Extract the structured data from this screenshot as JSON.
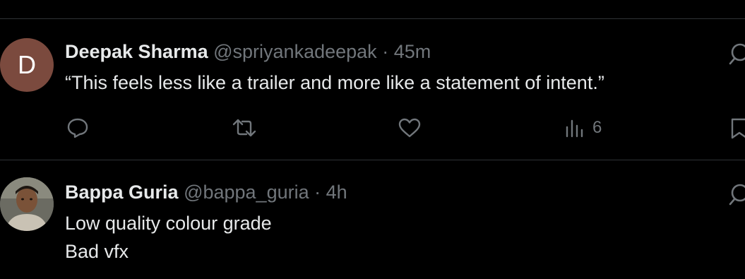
{
  "posts": [
    {
      "avatar_letter": "D",
      "name": "Deepak Sharma",
      "handle": "@spriyankadeepak",
      "separator": "·",
      "time": "45m",
      "text_lines": [
        "“This feels less like a trailer and more like a statement of intent.”"
      ],
      "views": "6"
    },
    {
      "name": "Bappa Guria",
      "handle": "@bappa_guria",
      "separator": "·",
      "time": "4h",
      "text_lines": [
        "Low quality colour grade",
        "Bad vfx"
      ]
    }
  ],
  "colors": {
    "background": "#000000",
    "text": "#e7e9ea",
    "secondary": "#71767b",
    "divider": "#2f3336",
    "avatar_bg": "#7b4a3e"
  }
}
